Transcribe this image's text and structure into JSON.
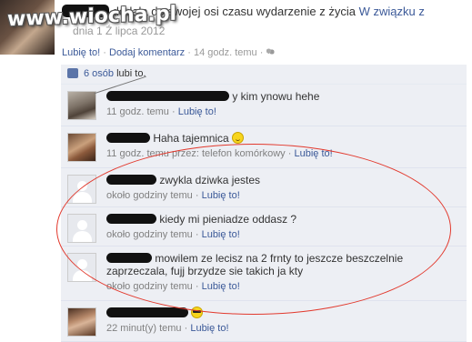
{
  "watermark": "www.wiocha.pl",
  "post": {
    "text_part": "dodała do swojej osi czasu wydarzenie z życia",
    "relationship_link": "W związku z",
    "sub": "dnia 1 Ź lipca 2012",
    "like": "Lubię to!",
    "comment": "Dodaj komentarz",
    "time": "14 godz. temu",
    "sep": "·"
  },
  "likes": {
    "count_link": "6 osób",
    "suffix": "lubi to."
  },
  "comments": [
    {
      "text": "y kim ynowu hehe",
      "time": "11 godz. temu",
      "like": "Lubię to!",
      "via": ""
    },
    {
      "text": "Haha tajemnica",
      "time": "11 godz. temu przez: telefon komórkowy",
      "like": "Lubię to!",
      "via": ""
    },
    {
      "text": "zwykla dziwka jestes",
      "time": "około godziny temu",
      "like": "Lubię to!"
    },
    {
      "text": "kiedy mi pieniadze oddasz ?",
      "time": "około godziny temu",
      "like": "Lubię to!"
    },
    {
      "text": "mowilem ze lecisz na 2 frnty to jeszcze beszczelnie zaprzeczala, fujj brzydze sie takich ja kty",
      "time": "około godziny temu",
      "like": "Lubię to!"
    },
    {
      "text": "",
      "time": "22 minut(y) temu",
      "like": "Lubię to!"
    }
  ],
  "sep": "·",
  "icons": {
    "thumb": "thumbs-up-icon",
    "people": "people-icon",
    "smiley": "smiley-emoticon",
    "cool": "sunglasses-emoticon"
  }
}
